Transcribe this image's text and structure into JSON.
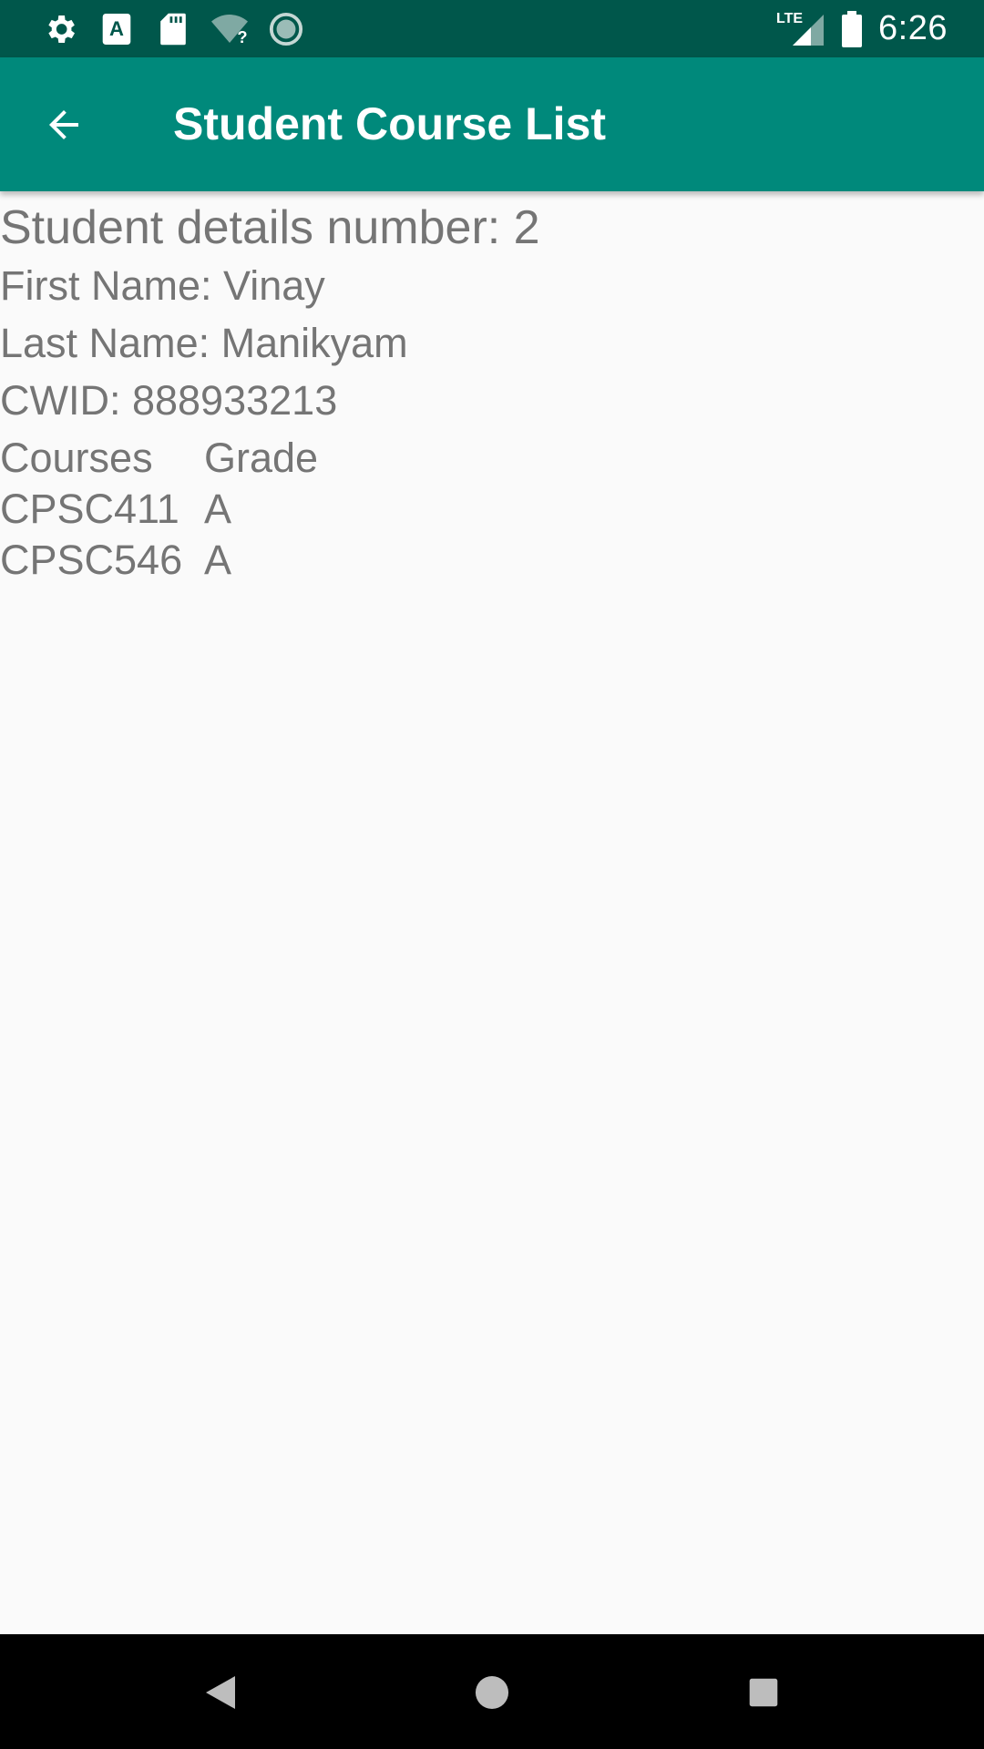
{
  "status_bar": {
    "time": "6:26",
    "network": "LTE",
    "icons": [
      "settings-icon",
      "text-a-icon",
      "sd-card-icon",
      "wifi-unknown-icon",
      "sync-circle-icon",
      "signal-icon",
      "battery-icon"
    ]
  },
  "app_bar": {
    "title": "Student Course List",
    "back_icon": "arrow-back-icon",
    "color": "#00897b"
  },
  "student": {
    "heading": "Student details number: 2",
    "first_name": "First Name: Vinay",
    "last_name": "Last Name: Manikyam",
    "cwid": "CWID: 888933213"
  },
  "courses_table": {
    "headers": [
      "Courses",
      "Grade"
    ],
    "rows": [
      [
        "CPSC411",
        "A"
      ],
      [
        "CPSC546",
        "A"
      ]
    ]
  },
  "nav_bar": {
    "buttons": [
      "back-triangle-icon",
      "home-circle-icon",
      "recents-square-icon"
    ]
  }
}
